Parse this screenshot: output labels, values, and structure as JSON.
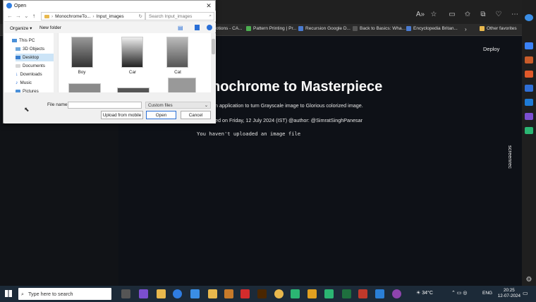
{
  "dialog": {
    "title": "Open",
    "path": [
      "MonochromeTo...",
      "Input_images"
    ],
    "search_placeholder": "Search Input_images",
    "organize_label": "Organize",
    "new_folder_label": "New folder",
    "nav_items": [
      "This PC",
      "3D Objects",
      "Desktop",
      "Documents",
      "Downloads",
      "Music",
      "Pictures"
    ],
    "files": [
      "Boy",
      "Car",
      "Cat"
    ],
    "file_name_label": "File name:",
    "file_type": "Custom files",
    "upload_mobile_label": "Upload from mobile",
    "open_label": "Open",
    "cancel_label": "Cancel"
  },
  "favorites": [
    "otions - CA...",
    "Pattern Printing | Pr...",
    "Recursion Google D...",
    "Back to Basics: Wha...",
    "Encyclopedia Britan...",
    "Other favorites"
  ],
  "app": {
    "deploy_label": "Deploy",
    "title": "nochrome to Masterpiece",
    "subtitle": "n application to turn Grayscale image to Glorious colorized image.",
    "credit": "ed on Friday, 12 July 2024 (IST) @author: @SimratSinghPanesar",
    "status": "You haven't uploaded an image file",
    "screenrec": "screenrec"
  },
  "taskbar": {
    "search_placeholder": "Type here to search",
    "weather": "34°C",
    "lang": "ENG",
    "time": "20:25",
    "date": "12-07-2024"
  }
}
